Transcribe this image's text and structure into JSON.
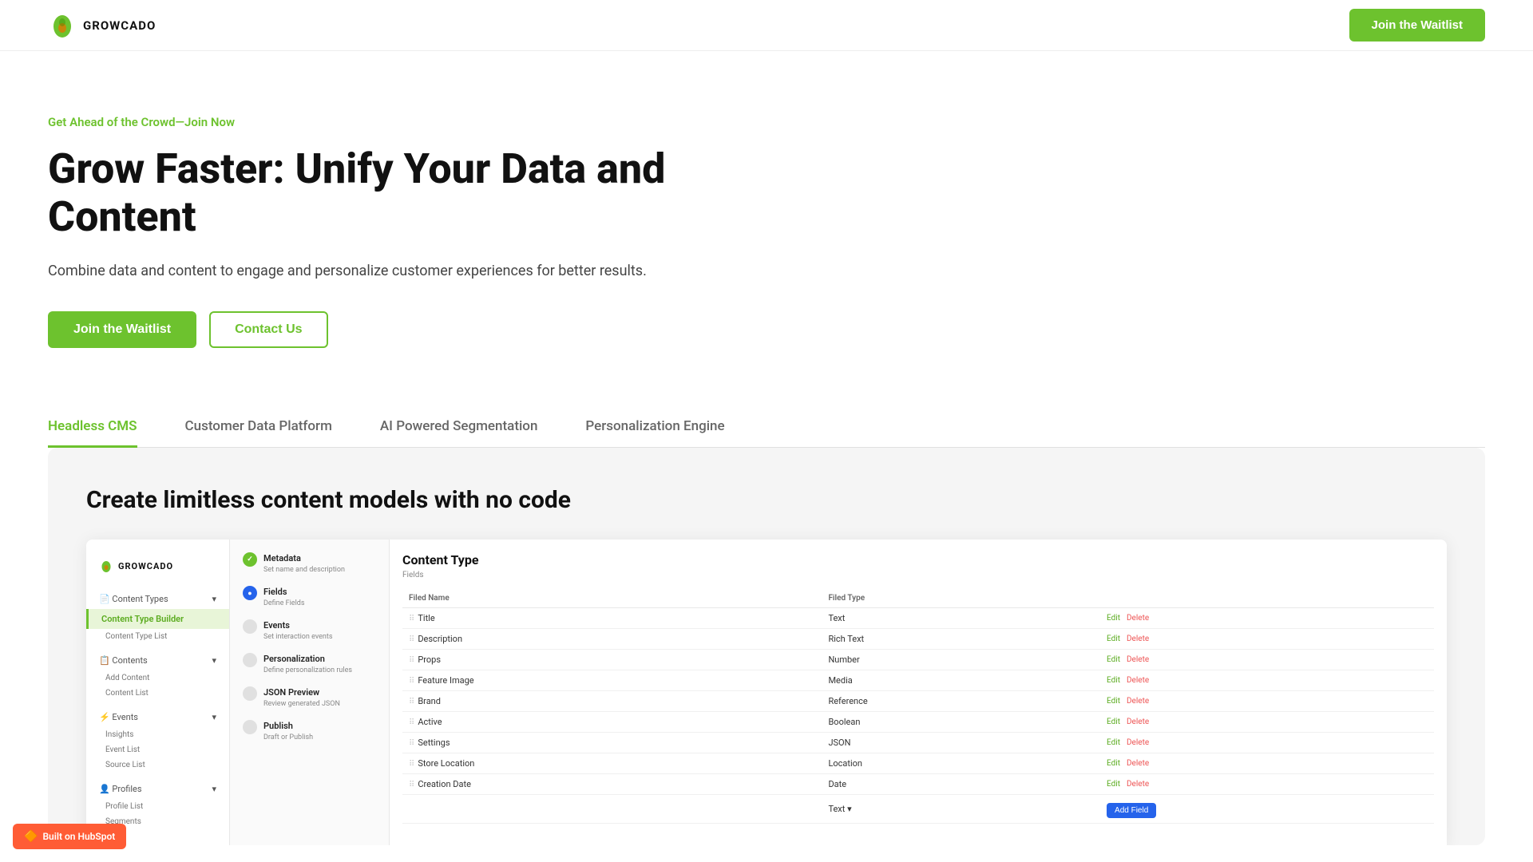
{
  "nav": {
    "logo_text": "GROWCADO",
    "cta_label": "Join the Waitlist"
  },
  "hero": {
    "eyebrow": "Get Ahead of the Crowd—Join Now",
    "title": "Grow Faster: Unify Your Data and Content",
    "subtitle": "Combine data and content to engage and personalize customer experiences for better results.",
    "btn_primary": "Join the Waitlist",
    "btn_secondary": "Contact Us"
  },
  "tabs": [
    {
      "id": "headless-cms",
      "label": "Headless CMS",
      "active": true
    },
    {
      "id": "customer-data-platform",
      "label": "Customer Data Platform",
      "active": false
    },
    {
      "id": "ai-powered-segmentation",
      "label": "AI Powered Segmentation",
      "active": false
    },
    {
      "id": "personalization-engine",
      "label": "Personalization Engine",
      "active": false
    }
  ],
  "panel": {
    "title": "Create limitless content models with no code",
    "sidebar": {
      "logo": "GROWCADO",
      "nav_items": [
        {
          "label": "Content Types",
          "expandable": true
        },
        {
          "label": "Content Type Builder",
          "active": true
        },
        {
          "label": "Content Type List",
          "sub": true
        },
        {
          "label": "Contents",
          "expandable": true
        },
        {
          "label": "Add Content",
          "sub": true
        },
        {
          "label": "Content List",
          "sub": true
        },
        {
          "label": "Events",
          "expandable": true
        },
        {
          "label": "Insights",
          "sub": true
        },
        {
          "label": "Event List",
          "sub": true
        },
        {
          "label": "Source List",
          "sub": true
        },
        {
          "label": "Profiles",
          "expandable": true
        },
        {
          "label": "Profile List",
          "sub": true
        },
        {
          "label": "Segments",
          "sub": true
        }
      ]
    },
    "steps": [
      {
        "label": "Metadata",
        "desc": "Set name and description",
        "state": "done"
      },
      {
        "label": "Fields",
        "desc": "Define Fields",
        "state": "active"
      },
      {
        "label": "Events",
        "desc": "Set interaction events",
        "state": "pending"
      },
      {
        "label": "Personalization",
        "desc": "Define personalization rules",
        "state": "pending"
      },
      {
        "label": "JSON Preview",
        "desc": "Review generated JSON",
        "state": "pending"
      },
      {
        "label": "Publish",
        "desc": "Draft or Publish",
        "state": "pending"
      }
    ],
    "table": {
      "title": "Content Type",
      "subtitle": "Fields",
      "col_field_name": "Filed Name",
      "col_field_type": "Filed Type",
      "rows": [
        {
          "name": "Title",
          "type": "Text"
        },
        {
          "name": "Description",
          "type": "Rich Text"
        },
        {
          "name": "Props",
          "type": "Number"
        },
        {
          "name": "Feature Image",
          "type": "Media"
        },
        {
          "name": "Brand",
          "type": "Reference"
        },
        {
          "name": "Active",
          "type": "Boolean"
        },
        {
          "name": "Settings",
          "type": "JSON"
        },
        {
          "name": "Store Location",
          "type": "Location"
        },
        {
          "name": "Creation Date",
          "type": "Date"
        },
        {
          "name": "",
          "type": "Text",
          "add_field": true
        }
      ],
      "btn_add": "Add Field"
    }
  },
  "hubspot": {
    "label": "Built on HubSpot"
  }
}
